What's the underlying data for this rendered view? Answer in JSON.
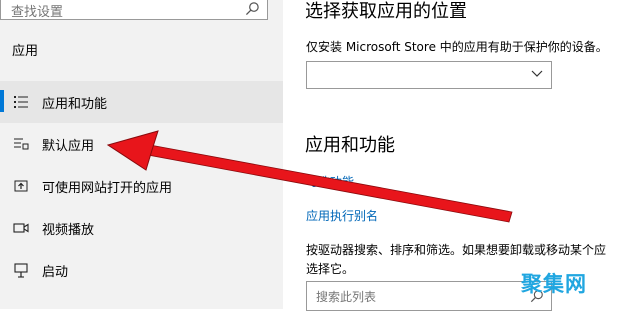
{
  "sidebar": {
    "search_placeholder": "查找设置",
    "section_title": "应用",
    "items": [
      {
        "label": "应用和功能",
        "icon": "apps-features-icon",
        "active": true
      },
      {
        "label": "默认应用",
        "icon": "default-apps-icon",
        "active": false
      },
      {
        "label": "可使用网站打开的应用",
        "icon": "apps-for-websites-icon",
        "active": false
      },
      {
        "label": "视频播放",
        "icon": "video-playback-icon",
        "active": false
      },
      {
        "label": "启动",
        "icon": "startup-icon",
        "active": false
      }
    ]
  },
  "main": {
    "install_heading": "选择获取应用的位置",
    "install_desc": "仅安装 Microsoft Store 中的应用有助于保护你的设备。",
    "install_dropdown_value": "",
    "apps_heading": "应用和功能",
    "optional_features_link": "可选功能",
    "execution_alias_link": "应用执行别名",
    "search_desc_line1": "按驱动器搜索、排序和筛选。如果想要卸载或移动某个应",
    "search_desc_line2": "选择它。",
    "list_search_placeholder": "搜索此列表"
  },
  "watermark": "聚集网",
  "colors": {
    "accent": "#0078d7",
    "link": "#0067b8",
    "arrow": "#e8151b",
    "watermark": "#20a6e0"
  }
}
